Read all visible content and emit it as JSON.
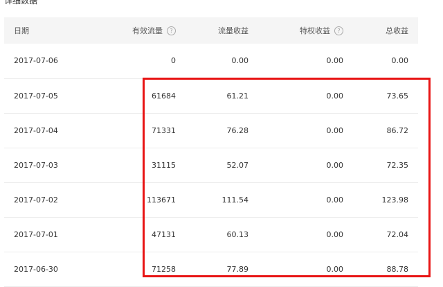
{
  "section_title": "详细数据",
  "table": {
    "headers": [
      {
        "label": "日期",
        "help": false
      },
      {
        "label": "有效流量",
        "help": true
      },
      {
        "label": "流量收益",
        "help": false
      },
      {
        "label": "特权收益",
        "help": true
      },
      {
        "label": "总收益",
        "help": false
      }
    ],
    "rows": [
      [
        "2017-07-06",
        "0",
        "0.00",
        "0.00",
        "0.00"
      ],
      [
        "2017-07-05",
        "61684",
        "61.21",
        "0.00",
        "73.65"
      ],
      [
        "2017-07-04",
        "71331",
        "76.28",
        "0.00",
        "86.72"
      ],
      [
        "2017-07-03",
        "31115",
        "52.07",
        "0.00",
        "72.35"
      ],
      [
        "2017-07-02",
        "113671",
        "111.54",
        "0.00",
        "123.98"
      ],
      [
        "2017-07-01",
        "47131",
        "60.13",
        "0.00",
        "72.04"
      ],
      [
        "2017-06-30",
        "71258",
        "77.89",
        "0.00",
        "88.78"
      ]
    ]
  },
  "help_icon_glyph": "?",
  "colors": {
    "highlight_box": "#e81414",
    "header_bg": "#f5f5f5"
  }
}
